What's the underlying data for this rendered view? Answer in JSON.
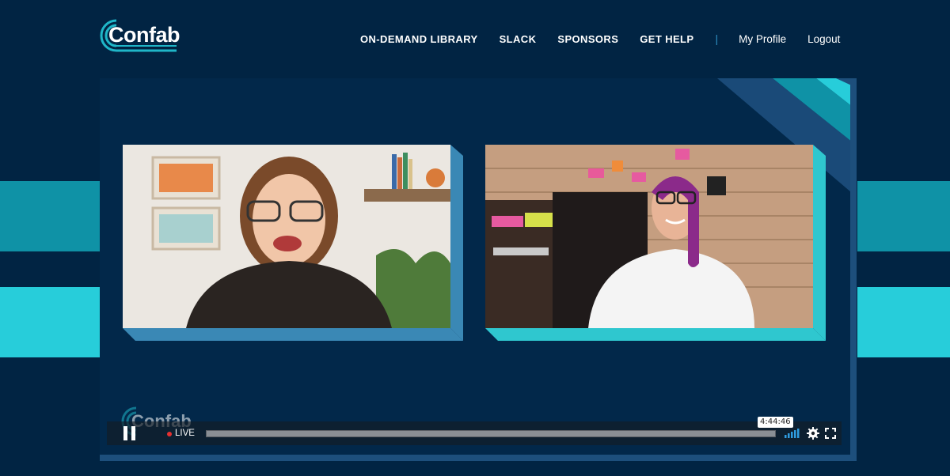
{
  "brand": {
    "logo_text": "Confab"
  },
  "nav": {
    "items": [
      {
        "label": "ON-DEMAND LIBRARY"
      },
      {
        "label": "SLACK"
      },
      {
        "label": "SPONSORS"
      },
      {
        "label": "GET HELP"
      }
    ],
    "separator": "|",
    "profile_label": "My Profile",
    "logout_label": "Logout"
  },
  "player": {
    "live_label": "LIVE",
    "time_tooltip": "4:44:46",
    "icons": [
      "pause-icon",
      "live-dot-icon",
      "signal-icon",
      "gear-icon",
      "fullscreen-icon"
    ],
    "watermark_text": "Confab"
  },
  "colors": {
    "background": "#012443",
    "stage": "#02284a",
    "teal_dark": "#0f92a6",
    "teal_light": "#27cdda",
    "frame_left_depth": "#3a88b5",
    "frame_right_depth": "#2fc7cf",
    "live": "#e53030"
  }
}
